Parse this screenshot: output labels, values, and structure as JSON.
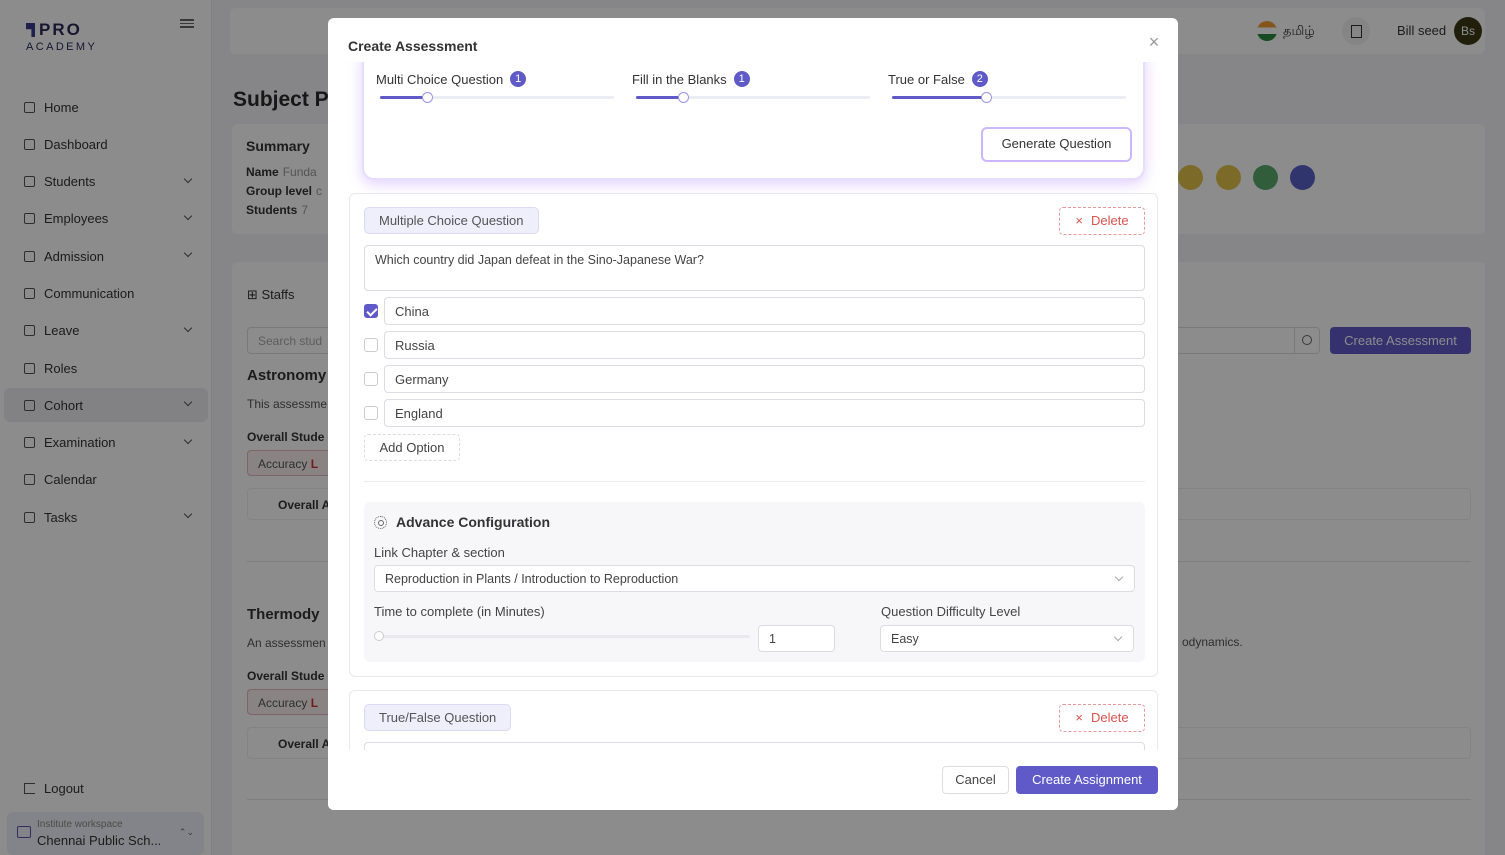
{
  "brand": {
    "line1": "PRO",
    "line2": "ACADEMY"
  },
  "sidebar": {
    "items": [
      {
        "label": "Home",
        "icon": "home-icon",
        "expandable": false
      },
      {
        "label": "Dashboard",
        "icon": "dashboard-icon",
        "expandable": false
      },
      {
        "label": "Students",
        "icon": "students-icon",
        "expandable": true
      },
      {
        "label": "Employees",
        "icon": "employees-icon",
        "expandable": true
      },
      {
        "label": "Admission",
        "icon": "admission-icon",
        "expandable": true
      },
      {
        "label": "Communication",
        "icon": "communication-icon",
        "expandable": false
      },
      {
        "label": "Leave",
        "icon": "leave-icon",
        "expandable": true
      },
      {
        "label": "Roles",
        "icon": "roles-icon",
        "expandable": false
      },
      {
        "label": "Cohort",
        "icon": "cohort-icon",
        "expandable": true,
        "active": true
      },
      {
        "label": "Examination",
        "icon": "examination-icon",
        "expandable": true
      },
      {
        "label": "Calendar",
        "icon": "calendar-icon",
        "expandable": false
      },
      {
        "label": "Tasks",
        "icon": "tasks-icon",
        "expandable": true
      }
    ],
    "logout": "Logout",
    "workspace": {
      "caption": "Institute workspace",
      "name": "Chennai Public Sch..."
    }
  },
  "topbar": {
    "language": "தமிழ்",
    "user_name": "Bill seed",
    "avatar_initials": "Bs"
  },
  "page": {
    "title": "Subject P",
    "summary": {
      "heading": "Summary",
      "name_label": "Name",
      "name_value": "Funda",
      "group_label": "Group level",
      "group_value": "c",
      "students_label": "Students",
      "students_value": "7"
    },
    "action_colors": [
      "#e2c24a",
      "#e2c24a",
      "#5aaa6a",
      "#5a62c8"
    ],
    "tab_staffs": "Staffs",
    "search_placeholder": "Search stud",
    "create_assessment": "Create Assessment",
    "sections": [
      {
        "title": "Astronomy",
        "desc": "This assessme",
        "overall_label": "Overall Stude",
        "accuracy": "Accuracy",
        "accuracy_suffix": "L",
        "overall_row": "Overall A"
      },
      {
        "title": "Thermody",
        "desc": "An assessmen",
        "overall_label": "Overall Stude",
        "accuracy": "Accuracy",
        "accuracy_suffix": "L",
        "overall_row": "Overall A",
        "desc_tail": "odynamics."
      }
    ]
  },
  "modal": {
    "title": "Create Assessment",
    "close": "×",
    "generator": {
      "types": [
        {
          "label": "Multi Choice Question",
          "count": "1",
          "level": 0.2
        },
        {
          "label": "Fill in the Blanks",
          "count": "1",
          "level": 0.2
        },
        {
          "label": "True or False",
          "count": "2",
          "level": 0.4
        }
      ],
      "generate_button": "Generate Question"
    },
    "question1": {
      "type_badge": "Multiple Choice Question",
      "delete_label": "Delete",
      "text": "Which country did Japan defeat in the Sino-Japanese War?",
      "options": [
        {
          "value": "China",
          "checked": true
        },
        {
          "value": "Russia",
          "checked": false
        },
        {
          "value": "Germany",
          "checked": false
        },
        {
          "value": "England",
          "checked": false
        }
      ],
      "add_option": "Add Option",
      "advanced": {
        "title": "Advance Configuration",
        "link_label": "Link Chapter & section",
        "link_value": "Reproduction in Plants / Introduction to Reproduction",
        "time_label": "Time to complete (in Minutes)",
        "time_value": "1",
        "difficulty_label": "Question Difficulty Level",
        "difficulty_value": "Easy"
      }
    },
    "question2": {
      "type_badge": "True/False Question",
      "delete_label": "Delete"
    },
    "footer": {
      "cancel": "Cancel",
      "submit": "Create Assignment"
    },
    "accent_color": "#5f5ac8"
  }
}
